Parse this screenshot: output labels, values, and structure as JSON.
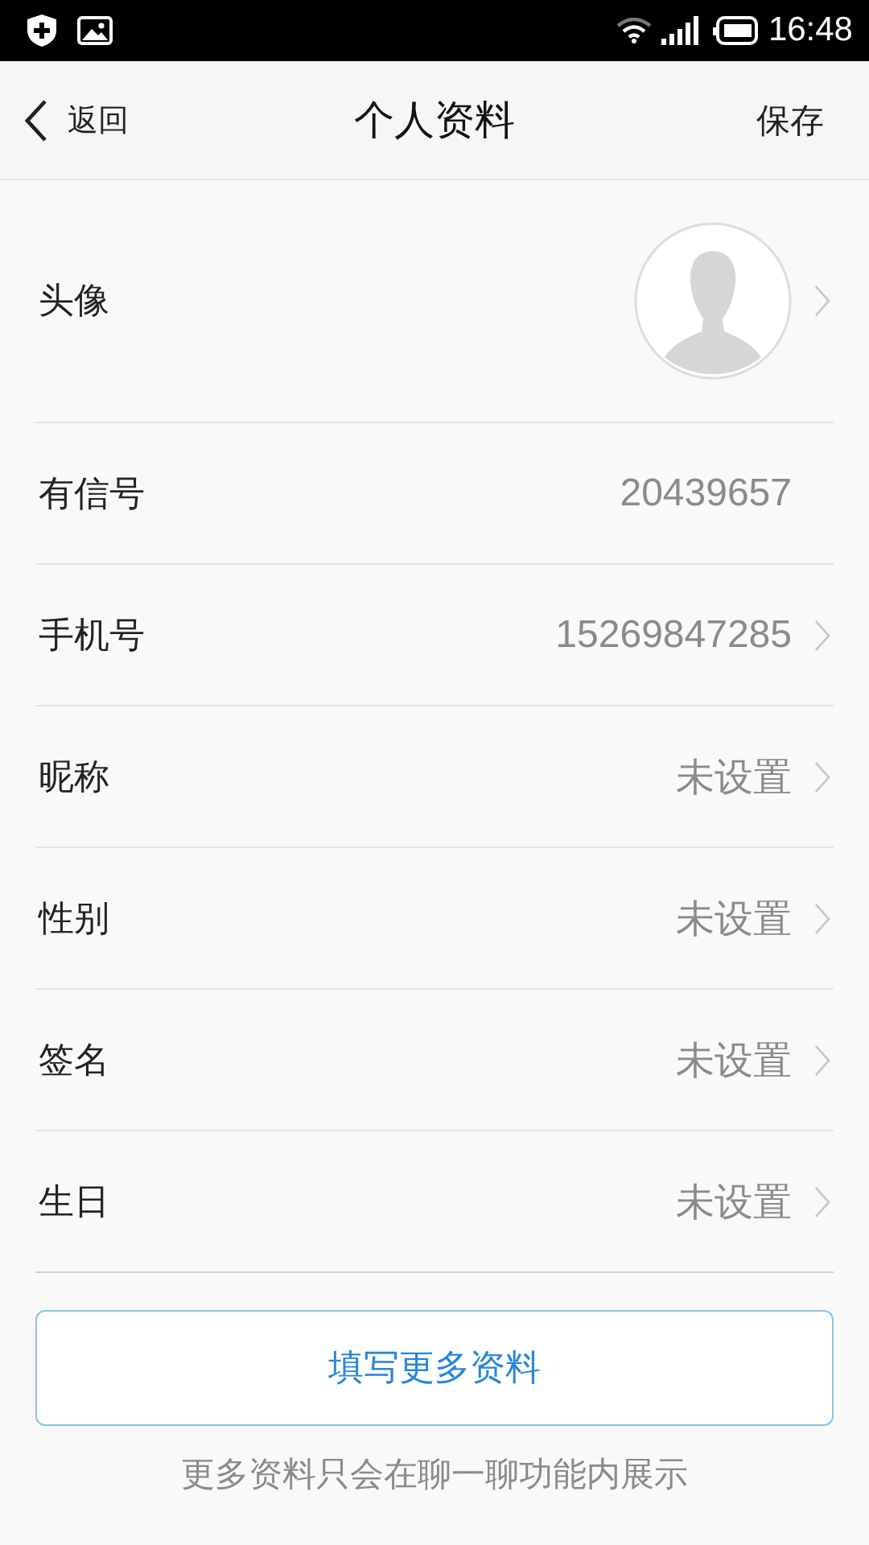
{
  "status_bar": {
    "time": "16:48"
  },
  "nav": {
    "back": "返回",
    "title": "个人资料",
    "action": "保存"
  },
  "rows": [
    {
      "kind": "avatar",
      "label": "头像",
      "chevron": true
    },
    {
      "kind": "text",
      "label": "有信号",
      "value": "20439657",
      "chevron": false
    },
    {
      "kind": "text",
      "label": "手机号",
      "value": "15269847285",
      "chevron": true
    },
    {
      "kind": "text",
      "label": "昵称",
      "value": "未设置",
      "chevron": true
    },
    {
      "kind": "text",
      "label": "性别",
      "value": "未设置",
      "chevron": true
    },
    {
      "kind": "text",
      "label": "签名",
      "value": "未设置",
      "chevron": true
    },
    {
      "kind": "text",
      "label": "生日",
      "value": "未设置",
      "chevron": true
    }
  ],
  "more_button": "填写更多资料",
  "footer_note": "更多资料只会在聊一聊功能内展示"
}
